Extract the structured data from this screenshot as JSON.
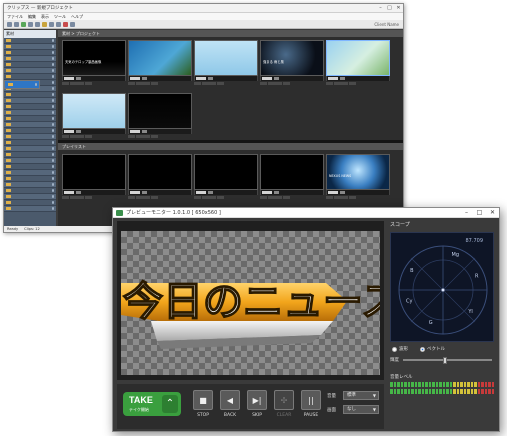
{
  "back_window": {
    "title": "クリップス — 新規プロジェクト",
    "menu": [
      "ファイル",
      "編集",
      "表示",
      "ツール",
      "ヘルプ"
    ],
    "user": "Client Name",
    "sidebar_header": "素材",
    "status": [
      "Ready",
      "Clips: 12"
    ],
    "tab1": "素材 > プロジェクト",
    "tab2": "プレイリスト",
    "thumb_captions": [
      "天気のテロップ製品画像",
      "",
      "",
      "強まる 雨と風",
      "",
      "",
      "",
      "",
      "",
      "",
      "",
      "NEXUS NEWS"
    ]
  },
  "live_window": {
    "title": "プレビューモニター 1.0.1.0 [ 650x560 ]",
    "scope_title": "スコープ",
    "scope_value": "87.709",
    "scope_labels": [
      "R",
      "Mg",
      "B",
      "Cy",
      "G",
      "Yl"
    ],
    "radio_options": [
      "波形",
      "ベクトル"
    ],
    "brightness_label": "輝度",
    "meter_label": "音量レベル",
    "preview_text": "今日のニュース",
    "take_label": "TAKE",
    "take_sub": "テイク開始",
    "take_arrow": "⌃",
    "buttons": [
      {
        "glyph": "■",
        "label": "STOP"
      },
      {
        "glyph": "◀",
        "label": "BACK"
      },
      {
        "glyph": "▶|",
        "label": "SKIP"
      },
      {
        "glyph": "✣",
        "label": "CLEAR"
      },
      {
        "glyph": "||",
        "label": "PAUSE"
      }
    ],
    "audio_label": "音量",
    "audio_value": "標準",
    "effect_label": "画面",
    "effect_value": "なし",
    "win_buttons": [
      "–",
      "□",
      "✕"
    ]
  },
  "colors": {
    "take_green": "#3a9f3e",
    "banner_gold": "#f2a51c",
    "meter_green": "#46b648",
    "meter_yellow": "#d4c23a",
    "meter_red": "#c63a3a"
  }
}
